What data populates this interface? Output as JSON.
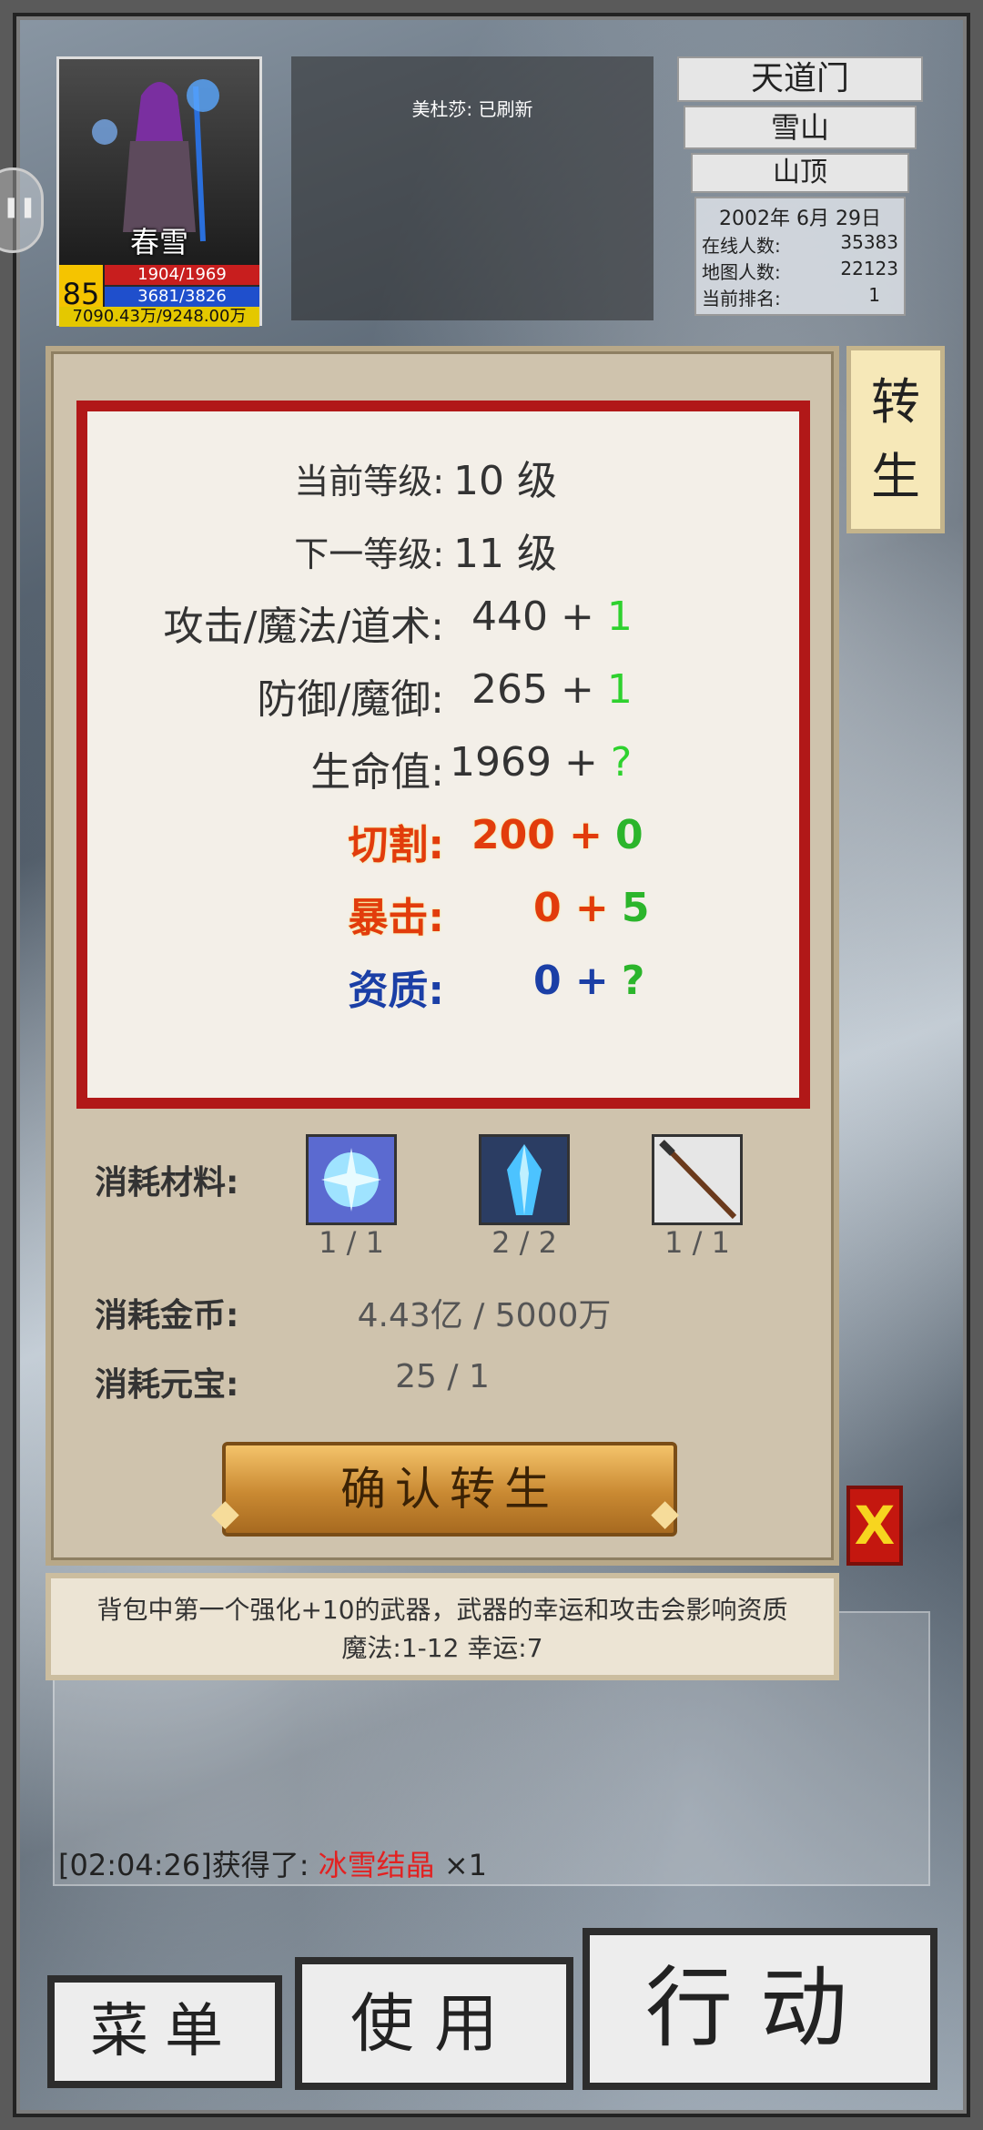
{
  "player": {
    "name": "春雪",
    "level": "85",
    "hp": "1904/1969",
    "mp": "3681/3826",
    "exp": "7090.43万/9248.00万"
  },
  "notice": "美杜莎: 已刷新",
  "map": {
    "sect": "天道门",
    "area": "雪山",
    "sub_area": "山顶",
    "date": "2002年 6月 29日",
    "online_label": "在线人数:",
    "online_value": "35383",
    "map_label": "地图人数:",
    "map_value": "22123",
    "rank_label": "当前排名:",
    "rank_value": "1"
  },
  "rebirth": {
    "tab_label_1": "转",
    "tab_label_2": "生",
    "stats": [
      {
        "label": "当前等级:",
        "base": "10 级",
        "add": ""
      },
      {
        "label": "下一等级:",
        "base": "11 级",
        "add": ""
      },
      {
        "label": "攻击/魔法/道术:",
        "base": "440 +",
        "add": "1"
      },
      {
        "label": "防御/魔御:",
        "base": "265 +",
        "add": "1"
      },
      {
        "label": "生命值:",
        "base": "1969 +",
        "add": "?"
      },
      {
        "label": "切割:",
        "base": "200 +",
        "add": "0"
      },
      {
        "label": "暴击:",
        "base": "0 +",
        "add": "5"
      },
      {
        "label": "资质:",
        "base": "0 +",
        "add": "?"
      }
    ],
    "materials_label": "消耗材料:",
    "materials": [
      {
        "icon": "ice-crystal-icon",
        "count": "1 / 1"
      },
      {
        "icon": "blue-gem-icon",
        "count": "2 / 2"
      },
      {
        "icon": "staff-icon",
        "count": "1 / 1"
      }
    ],
    "gold_label": "消耗金币:",
    "gold_value": "4.43亿  /  5000万",
    "ingot_label": "消耗元宝:",
    "ingot_value": "25  /  1",
    "confirm_label": "确认转生",
    "close_label": "X",
    "tip_line1": "背包中第一个强化+10的武器，武器的幸运和攻击会影响资质",
    "tip_line2": "魔法:1-12 幸运:7"
  },
  "log": {
    "prefix": "[02:04:26]获得了: ",
    "item": "冰雪结晶",
    "suffix": " ×1"
  },
  "bottom": {
    "menu": "菜单",
    "use": "使用",
    "action": "行动"
  },
  "colors": {
    "panel_border": "#b11818",
    "bonus_green": "#2ed12e",
    "highlight_red": "#e23c0c",
    "highlight_blue": "#1b3fa6",
    "level_gold": "#f5c400"
  }
}
